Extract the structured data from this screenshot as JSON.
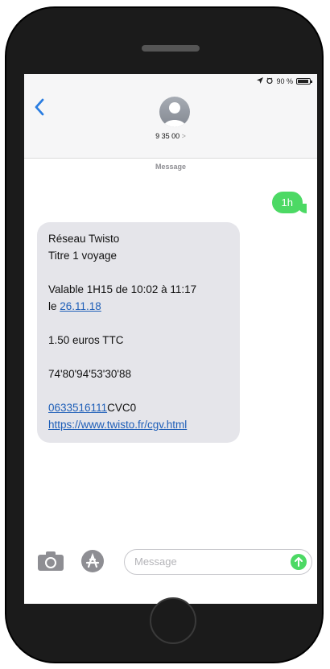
{
  "status": {
    "battery": "90 %"
  },
  "header": {
    "contact": "9 35 00",
    "contact_chevron": ">"
  },
  "thread": {
    "label": "Message"
  },
  "messages": {
    "outgoing": "1h",
    "incoming": {
      "line1": "Réseau Twisto",
      "line2": "Titre 1 voyage",
      "line3": "Valable 1H15 de 10:02 à 11:17",
      "line4_prefix": "le ",
      "line4_date": "26.11.18",
      "line5": "1.50 euros TTC",
      "line6": "74'80'94'53'30'88",
      "phone_link": "0633516111",
      "code": "CVC0",
      "url": "https://www.twisto.fr/cgv.html"
    }
  },
  "input": {
    "placeholder": "Message"
  },
  "colors": {
    "accent_green": "#4cd964",
    "link_blue": "#1f5fb8",
    "ios_blue": "#2a7de1",
    "bubble_gray": "#e5e5ea"
  }
}
